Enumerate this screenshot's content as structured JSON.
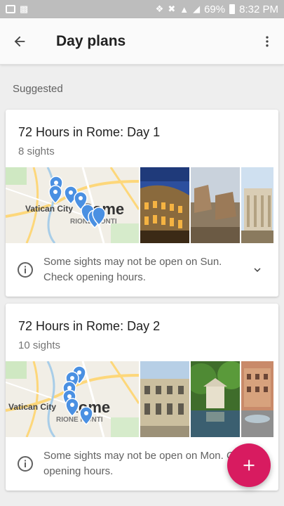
{
  "status_bar": {
    "battery": "69%",
    "time": "8:32 PM"
  },
  "app_bar": {
    "title": "Day plans"
  },
  "section": {
    "label": "Suggested"
  },
  "cards": [
    {
      "title": "72 Hours in Rome: Day 1",
      "subtitle": "8 sights",
      "map_labels": {
        "city": "Vatican City",
        "main": "Rome",
        "district": "RIONE MONTI"
      },
      "notice": "Some sights may not be open on Sun. Check opening hours."
    },
    {
      "title": "72 Hours in Rome: Day 2",
      "subtitle": "10 sights",
      "map_labels": {
        "city": "Vatican City",
        "main": "Rome",
        "district": "RIONE MONTI"
      },
      "notice": "Some sights may not be open on Mon. Check opening hours."
    }
  ],
  "fab": {
    "icon": "plus-icon",
    "color": "#d81b60"
  }
}
